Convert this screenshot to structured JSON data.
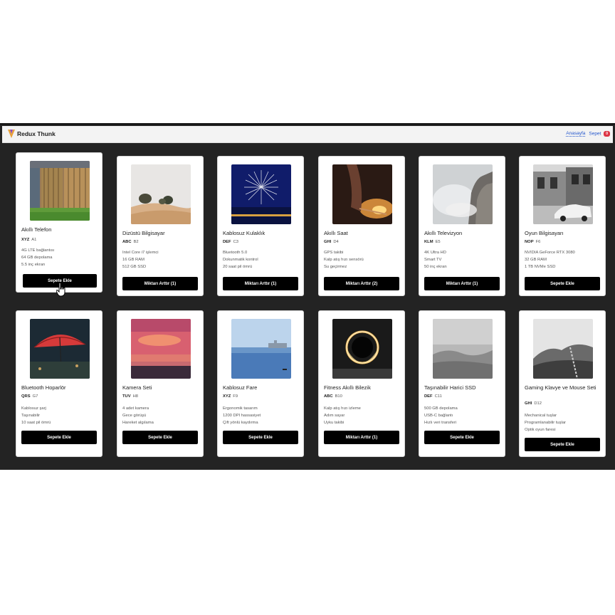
{
  "navbar": {
    "brand_title": "Redux Thunk",
    "home_link": "Anasayfa",
    "cart_link": "Sepet",
    "cart_count": "0"
  },
  "icons": {
    "brand": "redux-thunk-logo-icon",
    "cursor": "hand-pointer-icon"
  },
  "colors": {
    "button_bg": "#000000",
    "badge_bg": "#dc3545",
    "link": "#2255cc",
    "window_bg": "#232323"
  },
  "products": [
    {
      "name": "Akıllı Telefon",
      "brand": "XYZ",
      "code": "A1",
      "features": [
        "4G LTE bağlantısı",
        "64 GB depolama",
        "5.5 inç ekran"
      ],
      "button": "Sepete Ekle"
    },
    {
      "name": "Dizüstü Bilgisayar",
      "brand": "ABC",
      "code": "B2",
      "features": [
        "Intel Core i7 işlemci",
        "16 GB RAM",
        "512 GB SSD"
      ],
      "button": "Miktarı Arttır (1)"
    },
    {
      "name": "Kablosuz Kulaklık",
      "brand": "DEF",
      "code": "C3",
      "features": [
        "Bluetooth 5.0",
        "Dokunmatik kontrol",
        "20 saat pil ömrü"
      ],
      "button": "Miktarı Arttır (1)"
    },
    {
      "name": "Akıllı Saat",
      "brand": "GHI",
      "code": "D4",
      "features": [
        "GPS takibi",
        "Kalp atış hızı sensörü",
        "Su geçirmez"
      ],
      "button": "Miktarı Arttır (2)"
    },
    {
      "name": "Akıllı Televizyon",
      "brand": "KLM",
      "code": "E5",
      "features": [
        "4K Ultra HD",
        "Smart TV",
        "50 inç ekran"
      ],
      "button": "Miktarı Arttır (1)"
    },
    {
      "name": "Oyun Bilgisayarı",
      "brand": "NOP",
      "code": "F6",
      "features": [
        "NVIDIA GeForce RTX 3080",
        "32 GB RAM",
        "1 TB NVMe SSD"
      ],
      "button": "Sepete Ekle"
    },
    {
      "name": "Bluetooth Hoparlör",
      "brand": "QRS",
      "code": "G7",
      "features": [
        "Kablosuz şarj",
        "Taşınabilir",
        "10 saat pil ömrü"
      ],
      "button": "Sepete Ekle"
    },
    {
      "name": "Kamera Seti",
      "brand": "TUV",
      "code": "H8",
      "features": [
        "4 adet kamera",
        "Gece görüşü",
        "Hareket algılama"
      ],
      "button": "Sepete Ekle"
    },
    {
      "name": "Kablosuz Fare",
      "brand": "XYZ",
      "code": "F9",
      "features": [
        "Ergonomik tasarım",
        "1200 DPI hassasiyet",
        "Çift yönlü kaydırma"
      ],
      "button": "Sepete Ekle"
    },
    {
      "name": "Fitness Akıllı Bilezik",
      "brand": "ABC",
      "code": "B10",
      "features": [
        "Kalp atış hızı izleme",
        "Adım sayar",
        "Uyku takibi"
      ],
      "button": "Miktarı Arttır (1)"
    },
    {
      "name": "Taşınabilir Harici SSD",
      "brand": "DEF",
      "code": "C11",
      "features": [
        "500 GB depolama",
        "USB-C bağlantı",
        "Hızlı veri transferi"
      ],
      "button": "Sepete Ekle"
    },
    {
      "name": "Gaming Klavye ve Mouse Seti",
      "brand": "GHI",
      "code": "D12",
      "features": [
        "Mechanical tuşlar",
        "Programlanabilir tuşlar",
        "Optik oyun faresi"
      ],
      "button": "Sepete Ekle"
    }
  ]
}
